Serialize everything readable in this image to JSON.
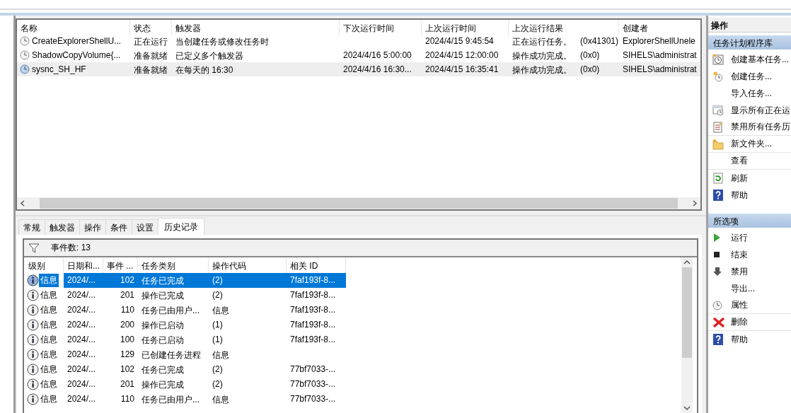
{
  "task_table": {
    "columns": [
      "名称",
      "状态",
      "触发器",
      "下次运行时间",
      "上次运行时间",
      "上次运行结果",
      "创建者"
    ],
    "rows": [
      {
        "name": "CreateExplorerShellU...",
        "status": "正在运行",
        "trigger": "当创建任务或修改任务时",
        "next_run": "",
        "last_run": "2024/4/15 9:45:54",
        "result": "正在运行任务。",
        "result_code": "(0x41301)",
        "author": "ExplorerShellUnele",
        "selected": false
      },
      {
        "name": "ShadowCopyVolume{...",
        "status": "准备就绪",
        "trigger": "已定义多个触发器",
        "next_run": "2024/4/16 5:00:00",
        "last_run": "2024/4/15 12:00:00",
        "result": "操作成功完成。",
        "result_code": "(0x0)",
        "author": "SIHELS\\administrat",
        "selected": false
      },
      {
        "name": "sysnc_SH_HF",
        "status": "准备就绪",
        "trigger": "在每天的 16:30",
        "next_run": "2024/4/16 16:30...",
        "last_run": "2024/4/15 16:35:41",
        "result": "操作成功完成。",
        "result_code": "(0x0)",
        "author": "SIHELS\\administrat",
        "selected": true
      }
    ]
  },
  "tabs": [
    {
      "label": "常规",
      "selected": false
    },
    {
      "label": "触发器",
      "selected": false
    },
    {
      "label": "操作",
      "selected": false
    },
    {
      "label": "条件",
      "selected": false
    },
    {
      "label": "设置",
      "selected": false
    },
    {
      "label": "历史记录",
      "selected": true
    }
  ],
  "history": {
    "event_count": "事件数: 13",
    "columns": [
      "级别",
      "日期和...",
      "事件 ...",
      "任务类别",
      "操作代码",
      "相关 ID"
    ],
    "rows": [
      {
        "level": "信息",
        "date": "2024/...",
        "event_id": "102",
        "category": "任务已完成",
        "op_code": "(2)",
        "related_id": "7faf193f-8...",
        "selected": true
      },
      {
        "level": "信息",
        "date": "2024/...",
        "event_id": "201",
        "category": "操作已完成",
        "op_code": "(2)",
        "related_id": "7faf193f-8...",
        "selected": false
      },
      {
        "level": "信息",
        "date": "2024/...",
        "event_id": "110",
        "category": "任务已由用户...",
        "op_code": "信息",
        "related_id": "7faf193f-8...",
        "selected": false
      },
      {
        "level": "信息",
        "date": "2024/...",
        "event_id": "200",
        "category": "操作已启动",
        "op_code": "(1)",
        "related_id": "7faf193f-8...",
        "selected": false
      },
      {
        "level": "信息",
        "date": "2024/...",
        "event_id": "100",
        "category": "任务已启动",
        "op_code": "(1)",
        "related_id": "7faf193f-8...",
        "selected": false
      },
      {
        "level": "信息",
        "date": "2024/...",
        "event_id": "129",
        "category": "已创建任务进程",
        "op_code": "信息",
        "related_id": "",
        "selected": false
      },
      {
        "level": "信息",
        "date": "2024/...",
        "event_id": "102",
        "category": "任务已完成",
        "op_code": "(2)",
        "related_id": "77bf7033-...",
        "selected": false
      },
      {
        "level": "信息",
        "date": "2024/...",
        "event_id": "201",
        "category": "操作已完成",
        "op_code": "(2)",
        "related_id": "77bf7033-...",
        "selected": false
      },
      {
        "level": "信息",
        "date": "2024/...",
        "event_id": "110",
        "category": "任务已由用户...",
        "op_code": "信息",
        "related_id": "77bf7033-...",
        "selected": false
      }
    ]
  },
  "actions_pane": {
    "title": "操作",
    "sections": [
      {
        "title": "任务计划程序库",
        "items": [
          {
            "label": "创建基本任务...",
            "kind": "calendar",
            "divider": false
          },
          {
            "label": "创建任务...",
            "kind": "clock-star",
            "divider": false
          },
          {
            "label": "导入任务...",
            "kind": "none",
            "divider": false
          },
          {
            "label": "显示所有正在运",
            "kind": "window-clock",
            "divider": false
          },
          {
            "label": "禁用所有任务历",
            "kind": "document",
            "divider": true
          },
          {
            "label": "新文件夹...",
            "kind": "folder",
            "divider": true
          },
          {
            "label": "查看",
            "kind": "none",
            "divider": true
          },
          {
            "label": "刷新",
            "kind": "refresh",
            "divider": false
          },
          {
            "label": "帮助",
            "kind": "help",
            "divider": false
          }
        ]
      },
      {
        "title": "所选项",
        "items": [
          {
            "label": "运行",
            "kind": "run",
            "divider": false
          },
          {
            "label": "结束",
            "kind": "stop",
            "divider": false
          },
          {
            "label": "禁用",
            "kind": "down",
            "divider": false
          },
          {
            "label": "导出...",
            "kind": "none",
            "divider": false
          },
          {
            "label": "属性",
            "kind": "clock",
            "divider": true
          },
          {
            "label": "删除",
            "kind": "delete",
            "divider": true
          },
          {
            "label": "帮助",
            "kind": "help",
            "divider": false
          }
        ]
      }
    ]
  }
}
